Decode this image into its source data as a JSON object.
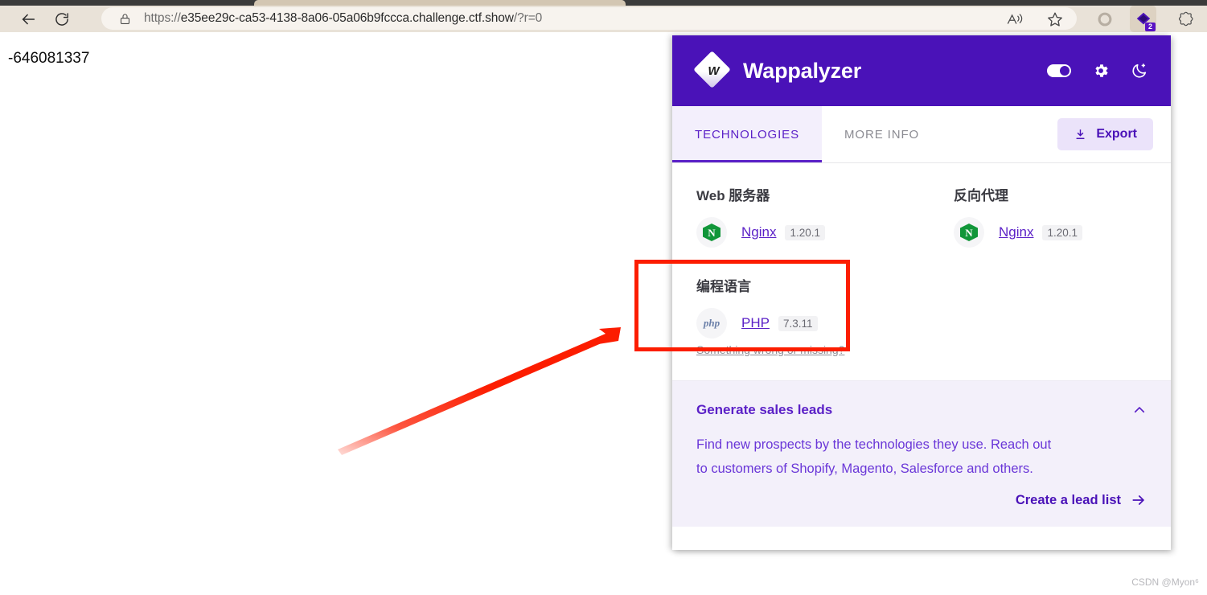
{
  "browser": {
    "back_icon": "arrow-left-icon",
    "reload_icon": "reload-icon",
    "lock_icon": "lock-icon",
    "url": "https://e35ee29c-ca53-4138-8a06-05a06b9fccca.challenge.ctf.show/?r=0",
    "url_scheme": "https://",
    "url_host": "e35ee29c-ca53-4138-8a06-05a06b9fccca.challenge.ctf.show",
    "url_path": "/?r=0",
    "toolbar_icons": [
      {
        "name": "read-aloud-icon",
        "glyph": "A"
      },
      {
        "name": "favorites-star-icon",
        "glyph": "☆"
      },
      {
        "name": "collections-icon",
        "glyph": "○"
      },
      {
        "name": "wappalyzer-extension-icon",
        "badge": "2"
      },
      {
        "name": "browser-essentials-icon",
        "glyph": "❀"
      }
    ]
  },
  "page": {
    "body_text": "-646081337"
  },
  "wappalyzer": {
    "title": "Wappalyzer",
    "logo_letter": "W",
    "header_icons": {
      "toggle": "power-toggle",
      "settings": "gear-icon",
      "theme": "moon-icon"
    },
    "tabs": [
      {
        "label": "TECHNOLOGIES",
        "active": true
      },
      {
        "label": "MORE INFO",
        "active": false
      }
    ],
    "export_label": "Export",
    "export_icon": "download-icon",
    "categories": [
      {
        "name": "Web 服务器",
        "technologies": [
          {
            "name": "Nginx",
            "version": "1.20.1",
            "icon": "nginx-icon"
          }
        ]
      },
      {
        "name": "反向代理",
        "technologies": [
          {
            "name": "Nginx",
            "version": "1.20.1",
            "icon": "nginx-icon"
          }
        ]
      },
      {
        "name": "编程语言",
        "technologies": [
          {
            "name": "PHP",
            "version": "7.3.11",
            "icon": "php-icon"
          }
        ]
      }
    ],
    "feedback_link": "Something wrong or missing?",
    "promo": {
      "title": "Generate sales leads",
      "collapse_icon": "chevron-up-icon",
      "body_line1": "Find new prospects by the technologies they use. Reach out",
      "body_line2": "to customers of Shopify, Magento, Salesforce and others.",
      "cta_label": "Create a lead list",
      "cta_icon": "arrow-right-icon"
    },
    "colors": {
      "header_purple": "#4a12b8",
      "accent_purple": "#5b21c7",
      "promo_bg": "#f3f0fa",
      "nginx_green": "#119639"
    }
  },
  "annotations": {
    "highlight_color": "#fc1d00",
    "highlight_target": "编程语言 / PHP",
    "arrow": "red-arrow"
  },
  "watermark": "CSDN @Myon⁶"
}
